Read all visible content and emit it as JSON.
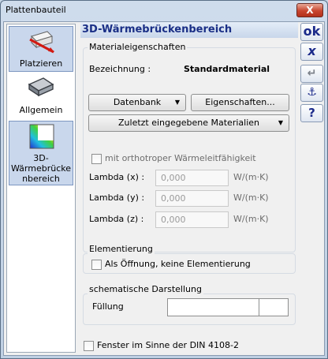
{
  "window": {
    "title": "Plattenbauteil",
    "close_label": "X"
  },
  "nav": {
    "items": [
      {
        "label": "Platzieren"
      },
      {
        "label": "Allgemein"
      },
      {
        "label": "3D-Wärmebrücke nbereich"
      }
    ]
  },
  "page": {
    "heading": "3D-Wärmebrückenbereich"
  },
  "material": {
    "group_title": "Materialeigenschaften",
    "bezeichnung_label": "Bezeichnung :",
    "bezeichnung_value": "Standardmaterial",
    "datenbank_label": "Datenbank",
    "eigenschaften_label": "Eigenschaften...",
    "zuletzt_label": "Zuletzt eingegebene Materialien",
    "orthotrop_label": "mit orthotroper Wärmeleitfähigkeit",
    "lambda_rows": [
      {
        "label": "Lambda (x) :",
        "value": "0,000",
        "unit": "W/(m·K)"
      },
      {
        "label": "Lambda (y) :",
        "value": "0,000",
        "unit": "W/(m·K)"
      },
      {
        "label": "Lambda (z) :",
        "value": "0,000",
        "unit": "W/(m·K)"
      }
    ]
  },
  "elementierung": {
    "group_title": "Elementierung",
    "checkbox_label": "Als Öffnung, keine Elementierung"
  },
  "schematic": {
    "group_title": "schematische Darstellung",
    "fuellung_label": "Füllung"
  },
  "fenster_label": "Fenster im Sinne der DIN 4108-2",
  "side_buttons": {
    "ok": "ok",
    "cancel": "x",
    "enter": "↵",
    "anchor": "⚓",
    "help": "?"
  }
}
